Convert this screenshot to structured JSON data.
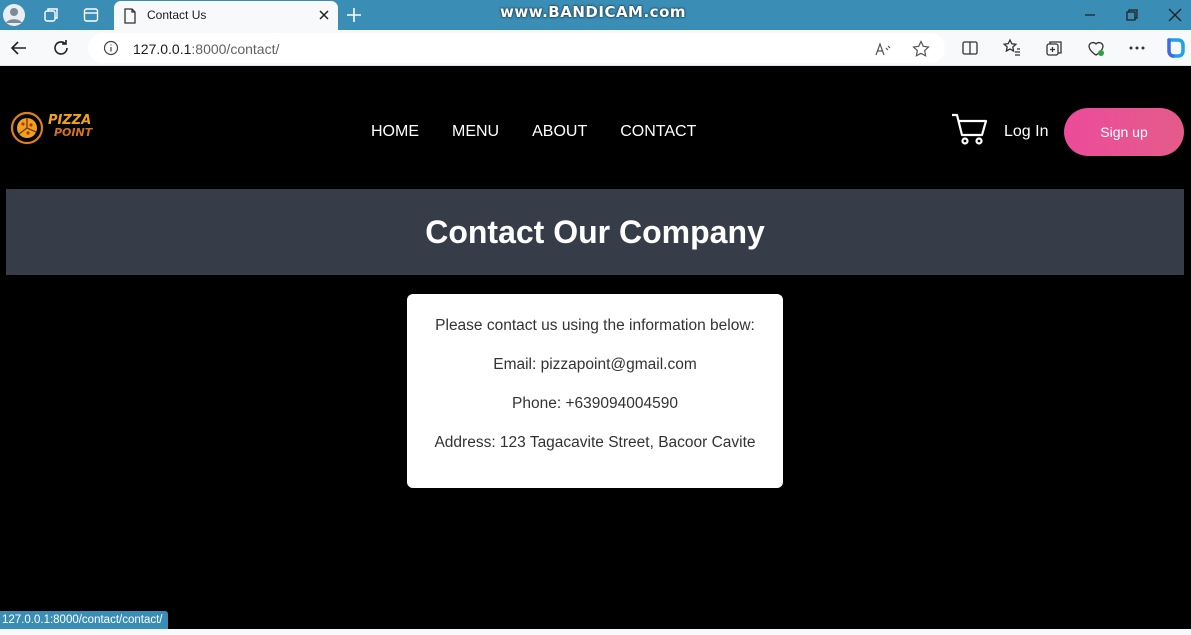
{
  "browser": {
    "tab_title": "Contact Us",
    "watermark": "www.BANDICAM.com",
    "url_host": "127.0.0.1",
    "url_path": ":8000/contact/",
    "status_url": "127.0.0.1:8000/contact/contact/"
  },
  "logo": {
    "line1": "PIZZA",
    "line2": "POINT"
  },
  "nav": {
    "items": [
      {
        "label": "HOME"
      },
      {
        "label": "MENU"
      },
      {
        "label": "ABOUT"
      },
      {
        "label": "CONTACT"
      }
    ]
  },
  "header": {
    "login": "Log In",
    "signup": "Sign up"
  },
  "banner": {
    "title": "Contact Our Company"
  },
  "contact": {
    "intro": "Please contact us using the information below:",
    "email": "Email: pizzapoint@gmail.com",
    "phone": "Phone: +639094004590",
    "address": "Address: 123 Tagacavite Street, Bacoor Cavite"
  },
  "colors": {
    "titlebar": "#3a8db5",
    "banner": "#363d49",
    "signup": "#ec4b9b",
    "logo": "#f0a21c"
  }
}
